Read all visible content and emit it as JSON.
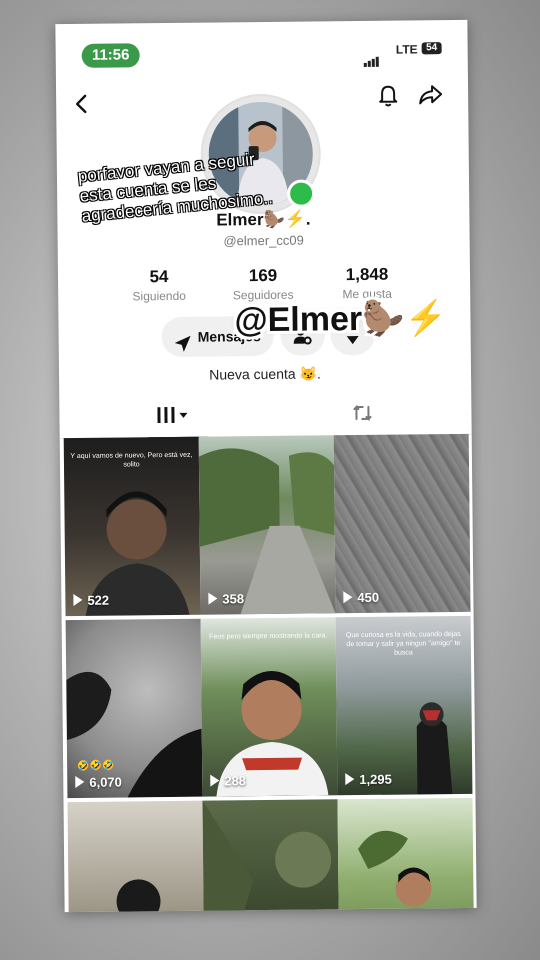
{
  "status_bar": {
    "time": "11:56",
    "network": "LTE",
    "battery": "54"
  },
  "profile": {
    "name": "Elmer🦫⚡.",
    "handle": "@elmer_cc09",
    "bio": "Nueva cuenta 😼.",
    "stats": [
      {
        "value": "54",
        "label": "Siguiendo"
      },
      {
        "value": "169",
        "label": "Seguidores"
      },
      {
        "value": "1,848",
        "label": "Me gusta"
      }
    ],
    "message_button": "Mensajes"
  },
  "overlay_text": "porfavor vayan a seguir esta cuenta se les agradecería muchosimo..",
  "sticker": "@Elmer🦫⚡",
  "videos": [
    {
      "views": "522",
      "caption": "Y aquí vamos de nuevo, Pero está vez, solito"
    },
    {
      "views": "358",
      "caption": ""
    },
    {
      "views": "450",
      "caption": ""
    },
    {
      "views": "6,070",
      "caption": "",
      "emojis": "🤣🤣🤣"
    },
    {
      "views": "288",
      "caption": "Feos pero siempre mostrando la cara."
    },
    {
      "views": "1,295",
      "caption": "Que curiosa es la vida, cuando dejas de tomar y salir ya ningun \"amigo\" te busca"
    },
    {
      "views": "",
      "caption": ""
    },
    {
      "views": "",
      "caption": ""
    },
    {
      "views": "",
      "caption": ""
    }
  ],
  "colors": {
    "time_pill": "#3a9a4a",
    "online_dot": "#2dbb4a"
  },
  "icons": [
    "back-arrow-icon",
    "bell-icon",
    "share-arrow-icon",
    "send-icon",
    "user-settings-icon",
    "chevron-down-icon",
    "grid-icon",
    "repost-icon",
    "play-icon"
  ]
}
